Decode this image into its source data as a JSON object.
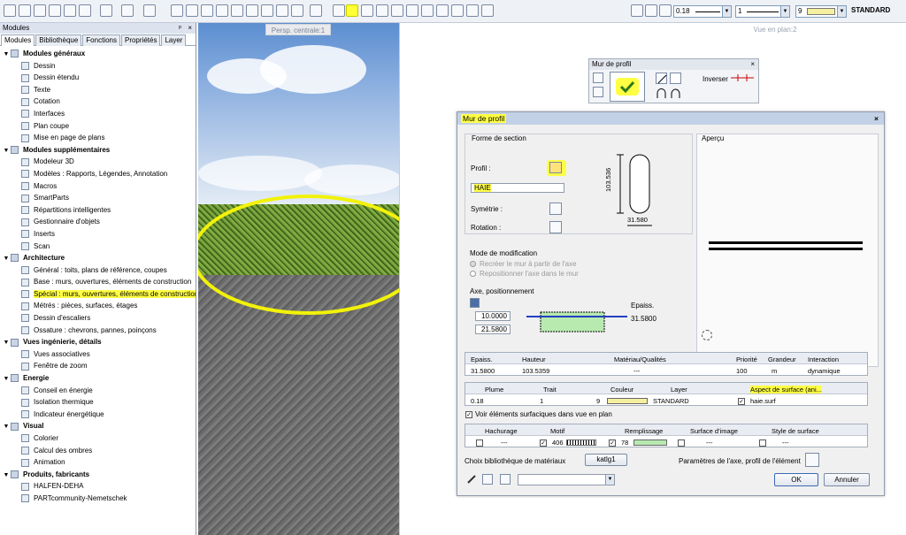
{
  "toolbar": {
    "pen_value": "0.18",
    "line_value": "1",
    "color_value": "9",
    "style_value": "STANDARD"
  },
  "left_panel": {
    "title": "Modules",
    "tabs": [
      "Modules",
      "Bibliothèque",
      "Fonctions",
      "Propriétés",
      "Layer"
    ],
    "tree": [
      {
        "label": "Modules généraux",
        "group": true
      },
      {
        "label": "Dessin"
      },
      {
        "label": "Dessin étendu"
      },
      {
        "label": "Texte"
      },
      {
        "label": "Cotation"
      },
      {
        "label": "Interfaces"
      },
      {
        "label": "Plan coupe"
      },
      {
        "label": "Mise en page de plans"
      },
      {
        "label": "Modules supplémentaires",
        "group": true
      },
      {
        "label": "Modeleur 3D"
      },
      {
        "label": "Modèles : Rapports, Légendes, Annotation"
      },
      {
        "label": "Macros"
      },
      {
        "label": "SmartParts"
      },
      {
        "label": "Répartitions intelligentes"
      },
      {
        "label": "Gestionnaire d'objets"
      },
      {
        "label": "Inserts"
      },
      {
        "label": "Scan"
      },
      {
        "label": "Architecture",
        "group": true
      },
      {
        "label": "Général : toits, plans de référence, coupes"
      },
      {
        "label": "Base : murs, ouvertures, éléments de construction"
      },
      {
        "label": "Spécial : murs, ouvertures, éléments de construction",
        "highlight": true
      },
      {
        "label": "Métrés : pièces, surfaces, étages"
      },
      {
        "label": "Dessin d'escaliers"
      },
      {
        "label": "Ossature : chevrons, pannes, poinçons"
      },
      {
        "label": "Vues ingénierie, détails",
        "group": true
      },
      {
        "label": "Vues associatives"
      },
      {
        "label": "Fenêtre de zoom"
      },
      {
        "label": "Energie",
        "group": true
      },
      {
        "label": "Conseil en énergie"
      },
      {
        "label": "Isolation thermique"
      },
      {
        "label": "Indicateur énergétique"
      },
      {
        "label": "Visual",
        "group": true
      },
      {
        "label": "Colorier"
      },
      {
        "label": "Calcul des ombres"
      },
      {
        "label": "Animation"
      },
      {
        "label": "Produits, fabricants",
        "group": true
      },
      {
        "label": "HALFEN-DEHA"
      },
      {
        "label": "PARTcommunity-Nemetschek"
      }
    ]
  },
  "viewports": {
    "left_label": "Persp. centrale:1",
    "right_label": "Vue en plan:2"
  },
  "mini_window": {
    "title": "Mur de profil",
    "close": "×",
    "invert_label": "Inverser"
  },
  "dialog": {
    "title": "Mur de profil",
    "close": "×",
    "section_form_label": "Forme de section",
    "preview_label": "Aperçu",
    "profile_label": "Profil :",
    "profile_value": "HAIE",
    "symmetry_label": "Symétrie :",
    "rotation_label": "Rotation :",
    "dim_height": "103.536",
    "dim_width": "31.580",
    "mode_label": "Mode de modification",
    "mode_opt1": "Recréer le mur à partir de l'axe",
    "mode_opt2": "Repositionner l'axe dans le mur",
    "axis_label": "Axe, positionnement",
    "axis_val1": "10.0000",
    "axis_val2": "21.5800",
    "epaiss_label": "Epaiss.",
    "epaiss_value": "31.5800",
    "table1": {
      "headers": [
        "Epaiss.",
        "Hauteur",
        "Matériau/Qualités",
        "Priorité",
        "Grandeur",
        "Interaction"
      ],
      "row": [
        "31.5800",
        "103.5359",
        "---",
        "100",
        "m",
        "dynamique"
      ]
    },
    "table2": {
      "headers": [
        "Plume",
        "Trait",
        "Couleur",
        "Layer",
        "Aspect de surface (ani..."
      ],
      "row": [
        "0.18",
        "1",
        "9",
        "STANDARD",
        "haie.surf"
      ]
    },
    "show_surfaces_label": "Voir éléments surfaciques dans vue en plan",
    "table3": {
      "headers": [
        "Hachurage",
        "Motif",
        "Remplissage",
        "Surface d'image",
        "Style de surface"
      ],
      "row": [
        "---",
        "406",
        "78",
        "---",
        "---"
      ]
    },
    "library_label": "Choix bibliothèque de matériaux",
    "library_button": "katlg1",
    "axis_params_label": "Paramètres de l'axe, profil de l'élément",
    "ok_button": "OK",
    "cancel_button": "Annuler"
  },
  "colors": {
    "highlight": "#ffff33",
    "title_bar": "#c3d1e6",
    "hedge": "#6f9a33"
  }
}
